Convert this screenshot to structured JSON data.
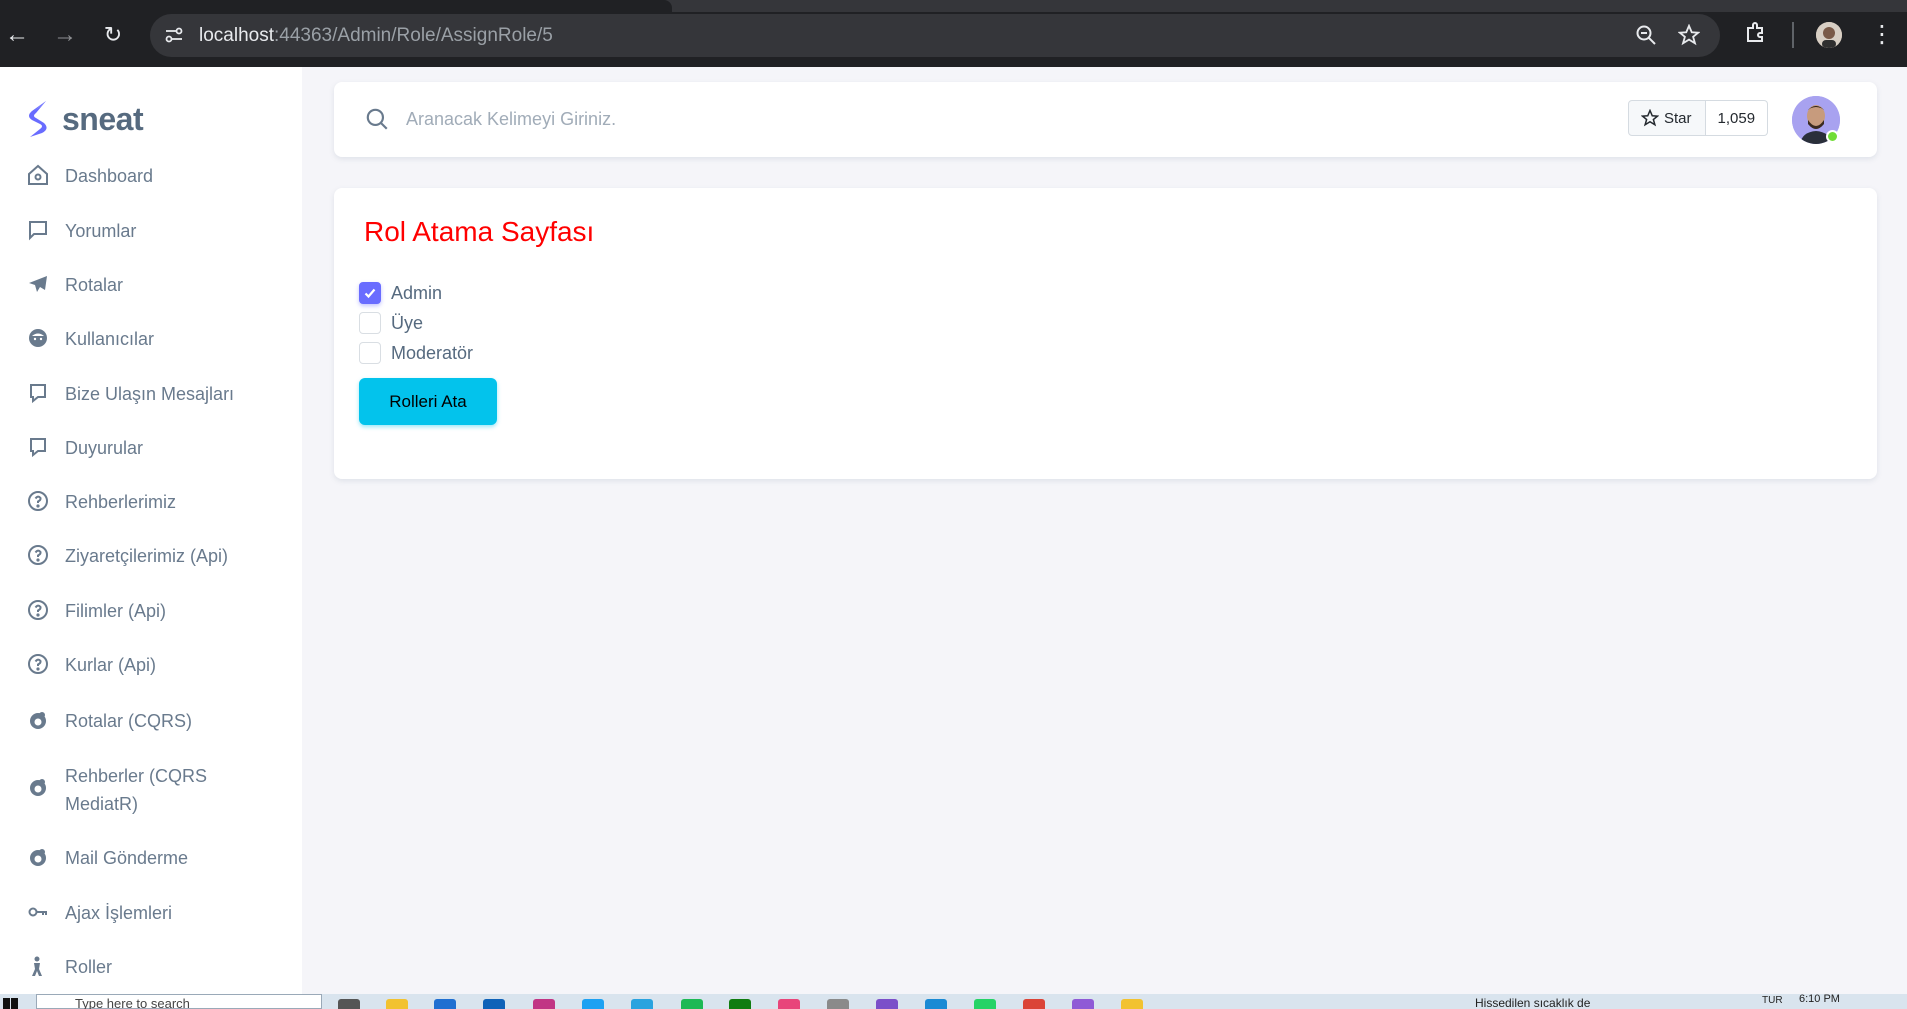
{
  "browser": {
    "url_host": "localhost",
    "url_path": ":44363/Admin/Role/AssignRole/5"
  },
  "brand": {
    "name": "sneat",
    "accent": "#696cff"
  },
  "sidebar": {
    "items": [
      {
        "label": "Dashboard",
        "icon": "home-icon"
      },
      {
        "label": "Yorumlar",
        "icon": "comment-icon"
      },
      {
        "label": "Rotalar",
        "icon": "plane-icon"
      },
      {
        "label": "Kullanıcılar",
        "icon": "user-face-icon"
      },
      {
        "label": "Bize Ulaşın Mesajları",
        "icon": "message-square-icon"
      },
      {
        "label": "Duyurular",
        "icon": "message-square-icon"
      },
      {
        "label": "Rehberlerimiz",
        "icon": "help-circle-icon"
      },
      {
        "label": "Ziyaretçilerimiz (Api)",
        "icon": "help-circle-icon"
      },
      {
        "label": "Filimler (Api)",
        "icon": "help-circle-icon"
      },
      {
        "label": "Kurlar (Api)",
        "icon": "help-circle-icon"
      },
      {
        "label": "Rotalar (CQRS)",
        "icon": "mailchimp-icon"
      },
      {
        "label": "Rehberler (CQRS MediatR)",
        "icon": "mailchimp-icon"
      },
      {
        "label": "Mail Gönderme",
        "icon": "mailchimp-icon"
      },
      {
        "label": "Ajax İşlemleri",
        "icon": "key-icon"
      },
      {
        "label": "Roller",
        "icon": "person-icon"
      }
    ]
  },
  "navbar": {
    "search_placeholder": "Aranacak Kelimeyi Giriniz.",
    "github_star_label": "Star",
    "github_star_count": "1,059"
  },
  "page": {
    "title": "Rol Atama Sayfası",
    "title_color": "#ff0000",
    "roles": [
      {
        "name": "Admin",
        "checked": true
      },
      {
        "name": "Üye",
        "checked": false
      },
      {
        "name": "Moderatör",
        "checked": false
      }
    ],
    "submit_label": "Rolleri Ata",
    "submit_color": "#03c3ec"
  },
  "taskbar": {
    "search_placeholder": "Type here to search",
    "weather_text": "Hissedilen sıcaklık de",
    "language": "TUR",
    "time": "6:10 PM"
  }
}
